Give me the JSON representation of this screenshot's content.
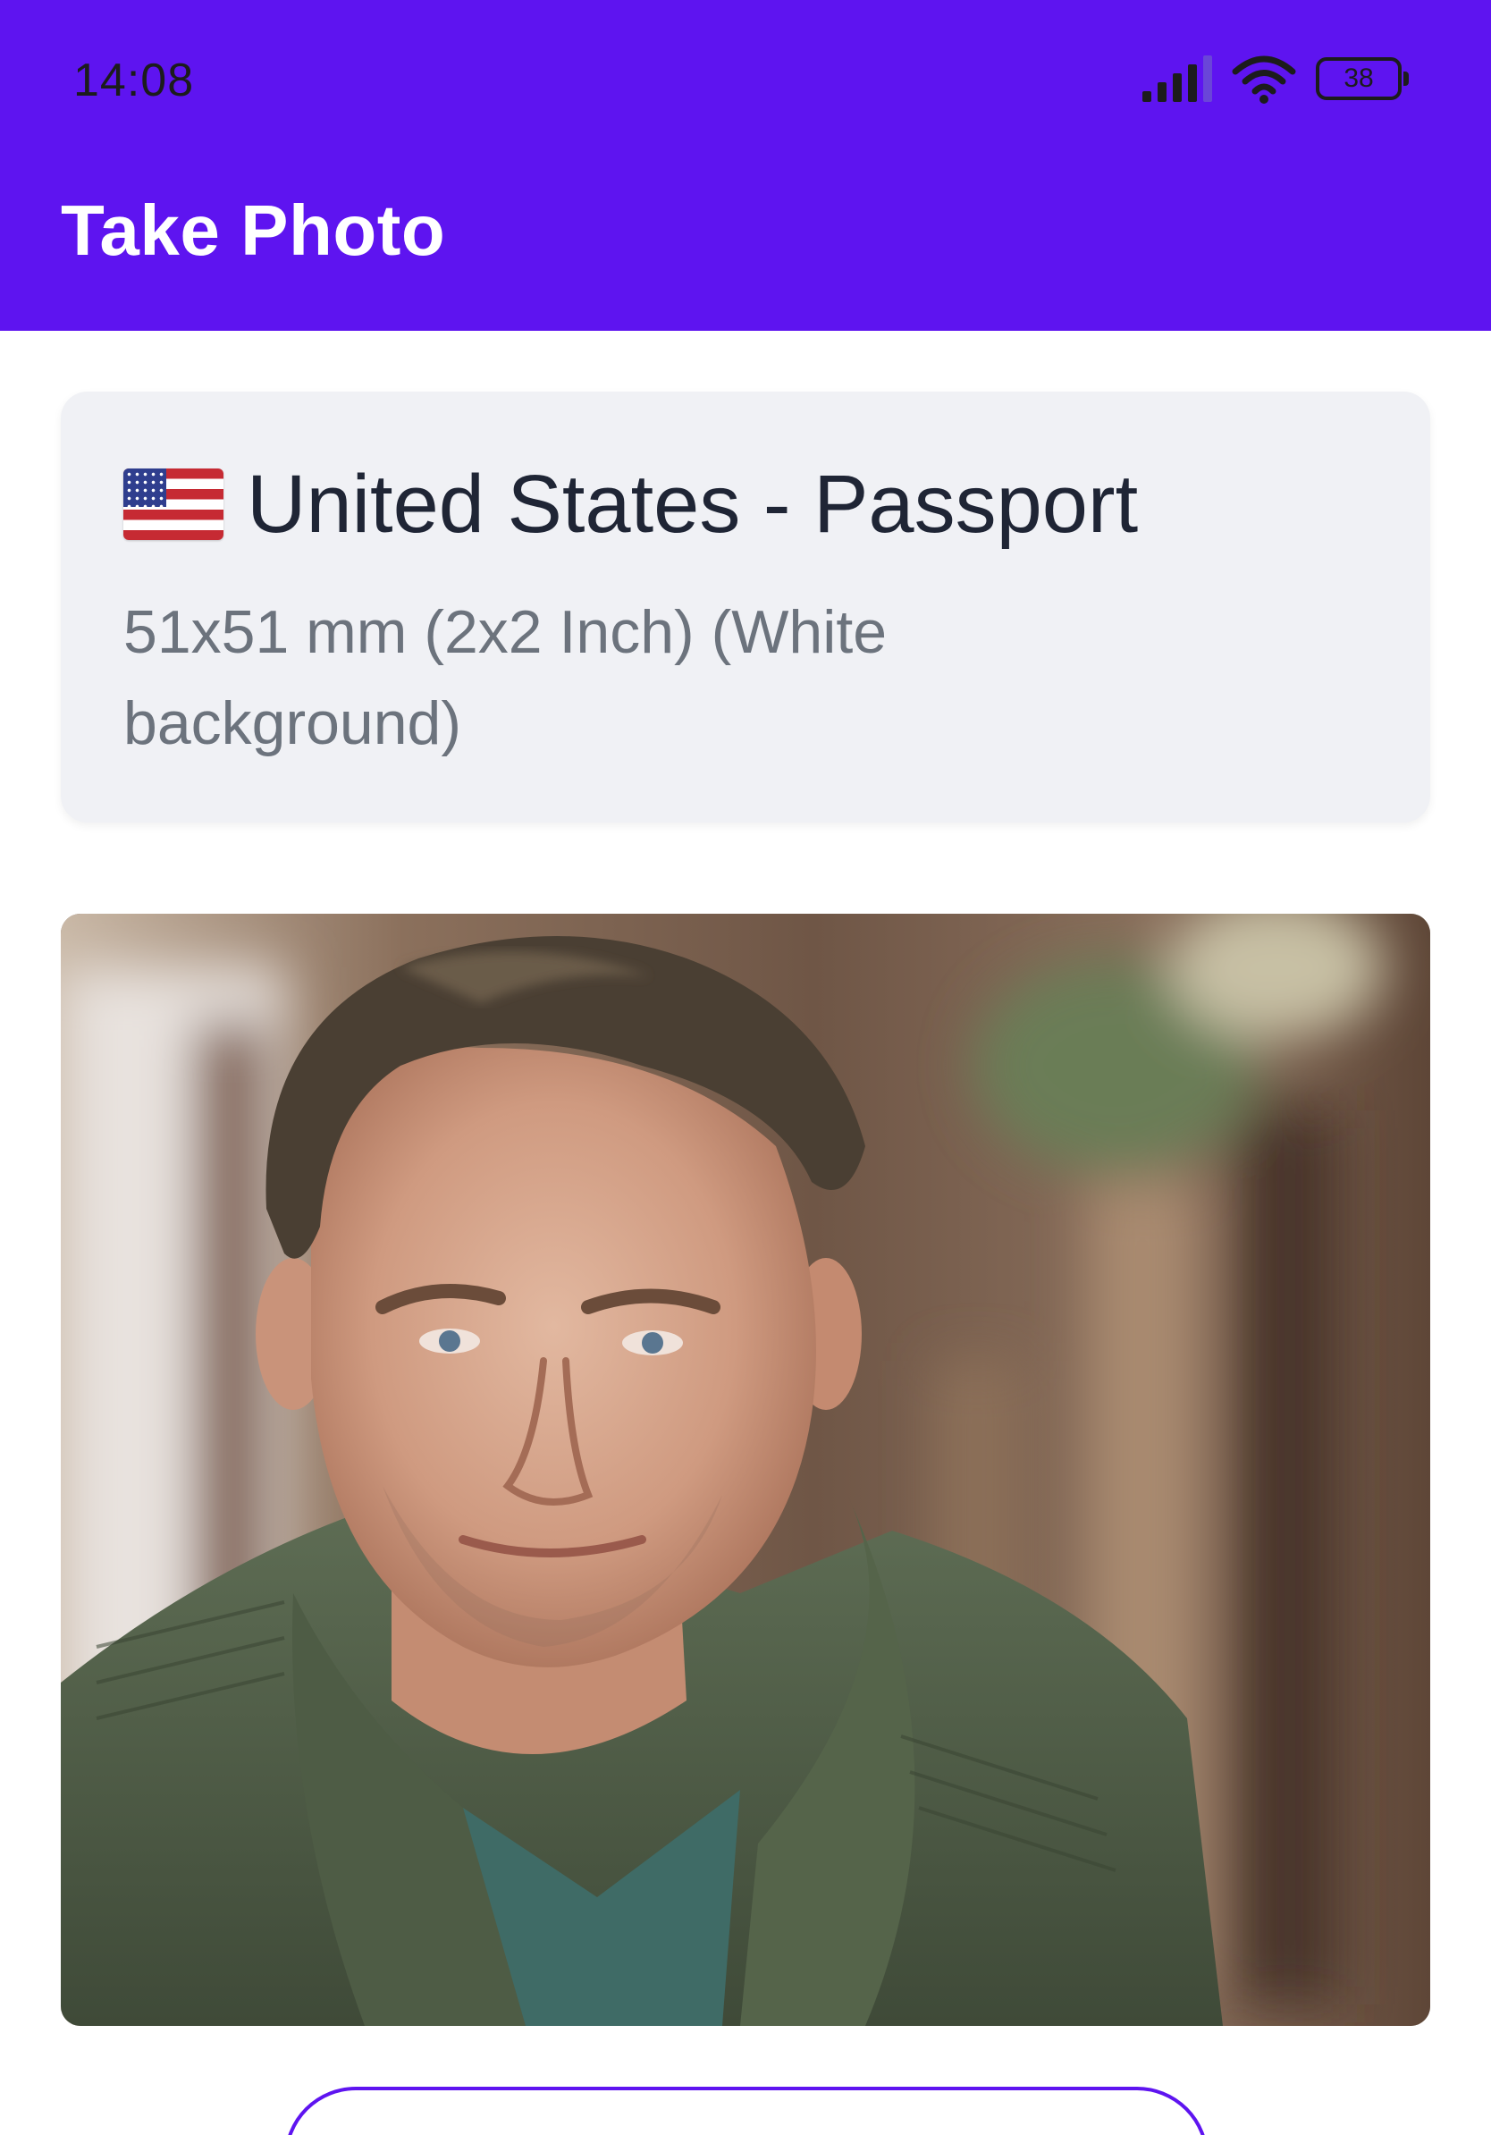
{
  "status_bar": {
    "time": "14:08",
    "battery": "38",
    "icons": [
      "signal-icon",
      "wifi-icon",
      "battery-icon"
    ]
  },
  "app_bar": {
    "title": "Take Photo",
    "color": "#5e14f0"
  },
  "document": {
    "flag": "us-flag-icon",
    "title": "United States - Passport",
    "size": "51x51 mm (2x2 Inch) (White background)"
  },
  "photo": {
    "description_icon": "portrait-photo"
  }
}
